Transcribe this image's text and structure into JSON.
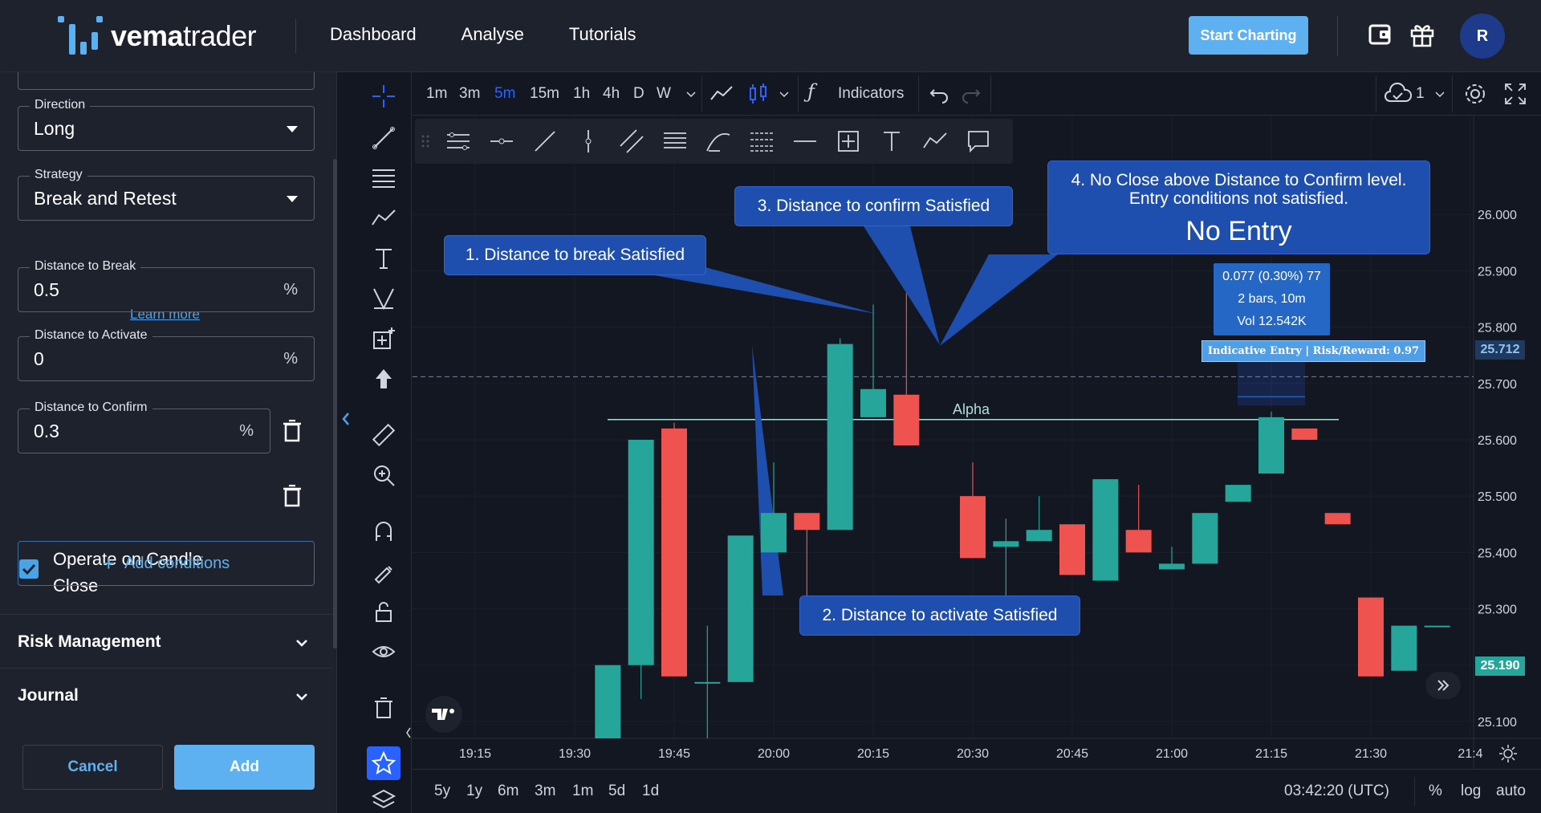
{
  "header": {
    "logo_bold": "vema",
    "logo_rest": "trader",
    "nav": [
      "Dashboard",
      "Analyse",
      "Tutorials"
    ],
    "start_button": "Start Charting",
    "avatar_initial": "R",
    "icons": [
      "wallet-icon",
      "gift-icon"
    ]
  },
  "panel": {
    "direction": {
      "label": "Direction",
      "value": "Long"
    },
    "strategy": {
      "label": "Strategy",
      "value": "Break and Retest"
    },
    "learn_more": "Learn more",
    "distance_to_break": {
      "label": "Distance to Break",
      "value": "0.5",
      "suffix": "%"
    },
    "distance_to_activate": {
      "label": "Distance to Activate",
      "value": "0",
      "suffix": "%"
    },
    "distance_to_confirm": {
      "label": "Distance to Confirm",
      "value": "0.3",
      "suffix": "%"
    },
    "operate_on_close": {
      "label": "Operate on Candle Close",
      "checked": true
    },
    "add_conditions": "Add conditions",
    "risk_management": "Risk Management",
    "journal": "Journal",
    "cancel": "Cancel",
    "add": "Add"
  },
  "chart_toolbar": {
    "timeframes": [
      "1m",
      "3m",
      "5m",
      "15m",
      "1h",
      "4h",
      "D",
      "W"
    ],
    "active_timeframe": "5m",
    "indicators": "Indicators",
    "layout_count": "1"
  },
  "chart": {
    "callouts": {
      "c1": "1. Distance to break Satisfied",
      "c2": "2. Distance to activate Satisfied",
      "c3": "3. Distance to confirm Satisfied",
      "c4_line1": "4. No Close above Distance to Confirm level.",
      "c4_line2": "Entry conditions not satisfied.",
      "c4_big": "No Entry"
    },
    "tooltip": {
      "line1": "0.077 (0.30%) 77",
      "line2": "2 bars, 10m",
      "line3": "Vol 12.542K"
    },
    "entry_label": "Indicative Entry | Risk/Reward: 0.97",
    "alpha_label": "Alpha",
    "price_tags": {
      "entry": "25.712",
      "current": "25.190"
    },
    "time_zone": "03:42:20 (UTC)",
    "ranges": [
      "5y",
      "1y",
      "6m",
      "3m",
      "1m",
      "5d",
      "1d"
    ],
    "scale_options": [
      "%",
      "log",
      "auto"
    ],
    "colors": {
      "up": "#26a69a",
      "down": "#ef5350",
      "callout": "#1f4fae",
      "accent": "#5eb1f0"
    }
  },
  "chart_data": {
    "type": "candlestick",
    "x_ticks": [
      "19:15",
      "19:30",
      "19:45",
      "20:00",
      "20:15",
      "20:30",
      "20:45",
      "21:00",
      "21:15",
      "21:30",
      "21:4"
    ],
    "y_ticks": [
      "26.000",
      "25.900",
      "25.800",
      "25.700",
      "25.600",
      "25.500",
      "25.400",
      "25.300",
      "25.200",
      "25.100"
    ],
    "ylim": [
      25.07,
      26.09
    ],
    "levels": {
      "entry": 25.712,
      "alpha": 25.636
    },
    "candles": [
      {
        "t": "19:35",
        "o": 25.07,
        "h": 25.2,
        "l": 25.07,
        "c": 25.2
      },
      {
        "t": "19:40",
        "o": 25.2,
        "h": 25.6,
        "l": 25.14,
        "c": 25.6
      },
      {
        "t": "19:45",
        "o": 25.62,
        "h": 25.63,
        "l": 25.18,
        "c": 25.18
      },
      {
        "t": "19:50",
        "o": 25.17,
        "h": 25.27,
        "l": 25.07,
        "c": 25.17
      },
      {
        "t": "19:55",
        "o": 25.17,
        "h": 25.43,
        "l": 25.17,
        "c": 25.43
      },
      {
        "t": "20:00",
        "o": 25.4,
        "h": 25.56,
        "l": 25.4,
        "c": 25.47
      },
      {
        "t": "20:05",
        "o": 25.47,
        "h": 25.47,
        "l": 25.3,
        "c": 25.44
      },
      {
        "t": "20:10",
        "o": 25.44,
        "h": 25.78,
        "l": 25.44,
        "c": 25.77
      },
      {
        "t": "20:15",
        "o": 25.64,
        "h": 25.84,
        "l": 25.64,
        "c": 25.69
      },
      {
        "t": "20:20",
        "o": 25.68,
        "h": 25.86,
        "l": 25.59,
        "c": 25.59
      },
      {
        "t": "20:30",
        "o": 25.5,
        "h": 25.56,
        "l": 25.39,
        "c": 25.39
      },
      {
        "t": "20:35",
        "o": 25.41,
        "h": 25.46,
        "l": 25.31,
        "c": 25.42
      },
      {
        "t": "20:40",
        "o": 25.42,
        "h": 25.5,
        "l": 25.42,
        "c": 25.44
      },
      {
        "t": "20:45",
        "o": 25.45,
        "h": 25.45,
        "l": 25.36,
        "c": 25.36
      },
      {
        "t": "20:50",
        "o": 25.35,
        "h": 25.53,
        "l": 25.35,
        "c": 25.53
      },
      {
        "t": "20:55",
        "o": 25.44,
        "h": 25.52,
        "l": 25.4,
        "c": 25.4
      },
      {
        "t": "21:00",
        "o": 25.37,
        "h": 25.41,
        "l": 25.37,
        "c": 25.38
      },
      {
        "t": "21:05",
        "o": 25.38,
        "h": 25.47,
        "l": 25.38,
        "c": 25.47
      },
      {
        "t": "21:10",
        "o": 25.49,
        "h": 25.52,
        "l": 25.49,
        "c": 25.52
      },
      {
        "t": "21:15",
        "o": 25.54,
        "h": 25.65,
        "l": 25.54,
        "c": 25.64
      },
      {
        "t": "21:20",
        "o": 25.62,
        "h": 25.62,
        "l": 25.6,
        "c": 25.6
      },
      {
        "t": "21:25",
        "o": 25.47,
        "h": 25.47,
        "l": 25.45,
        "c": 25.45
      },
      {
        "t": "21:30",
        "o": 25.32,
        "h": 25.32,
        "l": 25.18,
        "c": 25.18
      },
      {
        "t": "21:35",
        "o": 25.19,
        "h": 25.27,
        "l": 25.19,
        "c": 25.27
      },
      {
        "t": "21:40",
        "o": 25.27,
        "h": 25.27,
        "l": 25.27,
        "c": 25.27
      }
    ]
  }
}
